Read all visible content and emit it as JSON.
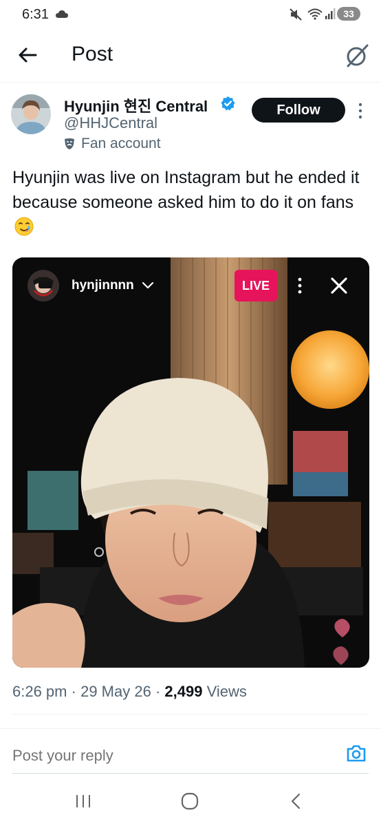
{
  "status_bar": {
    "time": "6:31",
    "battery": "33"
  },
  "header": {
    "title": "Post",
    "back_icon": "arrow-left-icon",
    "grok_icon": "grok-icon"
  },
  "author": {
    "display_name": "Hyunjin 현진 Central",
    "handle": "@HHJCentral",
    "label": "Fan account",
    "follow_label": "Follow",
    "verified_color": "#1d9bf0"
  },
  "tweet": {
    "text": "Hyunjin was live on Instagram but he ended it because someone asked him to do it on fans",
    "emoji": "face-savoring-crying-emoji"
  },
  "media": {
    "username": "hynjinnnn",
    "live_label": "LIVE",
    "live_color": "#e6145a"
  },
  "meta": {
    "time": "6:26 pm",
    "separator": "·",
    "date": "29 May 26",
    "views_count": "2,499",
    "views_label": "Views"
  },
  "reply": {
    "placeholder": "Post your reply",
    "accent_color": "#1d9bf0"
  }
}
